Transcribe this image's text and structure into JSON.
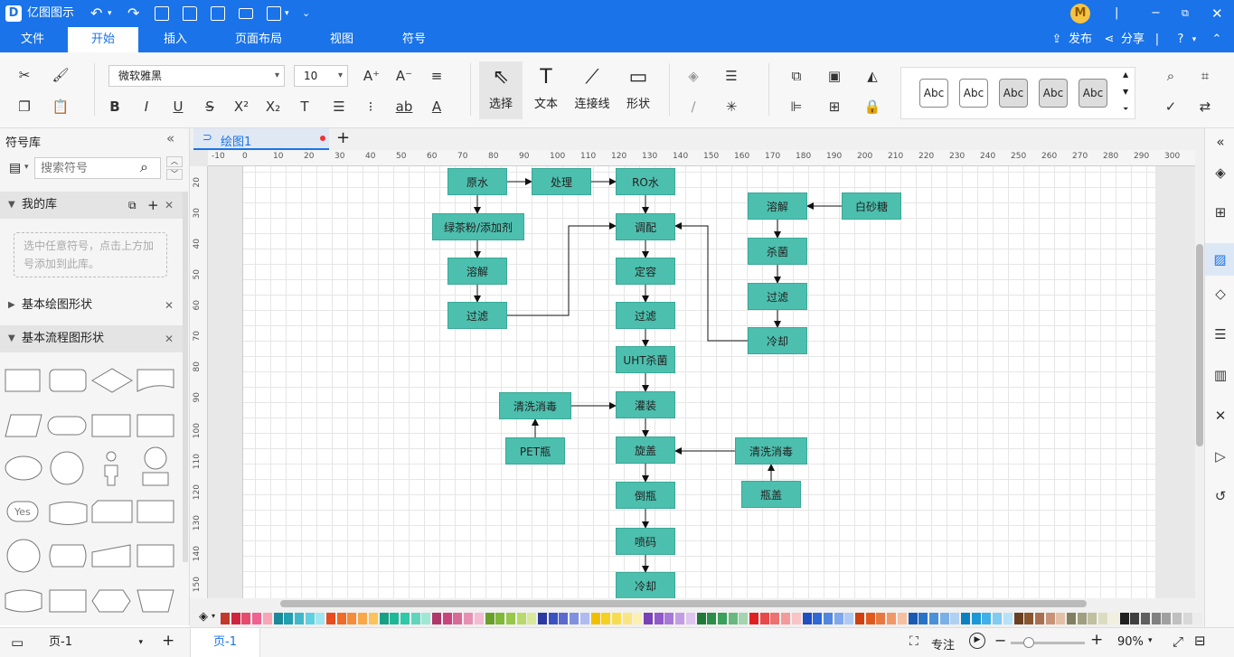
{
  "app": {
    "title": "亿图图示",
    "logo": "D"
  },
  "user": {
    "avatar_letter": "M"
  },
  "menu": {
    "items": [
      "文件",
      "开始",
      "插入",
      "页面布局",
      "视图",
      "符号"
    ],
    "active": "开始",
    "publish": "发布",
    "share": "分享"
  },
  "ribbon": {
    "font": "微软雅黑",
    "size": "10",
    "tools": [
      {
        "label": "选择"
      },
      {
        "label": "文本"
      },
      {
        "label": "连接线"
      },
      {
        "label": "形状"
      }
    ],
    "style_label": "Abc"
  },
  "left_panel": {
    "title": "符号库",
    "search_placeholder": "搜索符号",
    "my_lib": "我的库",
    "my_lib_hint": "选中任意符号，点击上方加号添加到此库。",
    "basic_shapes": "基本绘图形状",
    "flow_shapes": "基本流程图形状",
    "yes_label": "Yes"
  },
  "tab": {
    "name": "绘图1"
  },
  "ruler": {
    "h": [
      "-10",
      "0",
      "10",
      "20",
      "30",
      "40",
      "50",
      "60",
      "70",
      "80",
      "90",
      "100",
      "110",
      "120",
      "130",
      "140",
      "150",
      "160",
      "170",
      "180",
      "190",
      "200",
      "210",
      "220",
      "230",
      "240",
      "250",
      "260",
      "270",
      "280",
      "290",
      "300"
    ],
    "v": [
      "20",
      "30",
      "40",
      "50",
      "60",
      "70",
      "80",
      "90",
      "100",
      "110",
      "120",
      "130",
      "140",
      "150"
    ]
  },
  "diagram": {
    "nodes": [
      {
        "id": "n1",
        "label": "原水"
      },
      {
        "id": "n2",
        "label": "处理"
      },
      {
        "id": "n3",
        "label": "RO水"
      },
      {
        "id": "n4",
        "label": "绿茶粉/添加剂"
      },
      {
        "id": "n5",
        "label": "溶解"
      },
      {
        "id": "n6",
        "label": "过滤"
      },
      {
        "id": "n7",
        "label": "调配"
      },
      {
        "id": "n8",
        "label": "定容"
      },
      {
        "id": "n9",
        "label": "过滤"
      },
      {
        "id": "n10",
        "label": "UHT杀菌"
      },
      {
        "id": "n11",
        "label": "灌装"
      },
      {
        "id": "n12",
        "label": "旋盖"
      },
      {
        "id": "n13",
        "label": "倒瓶"
      },
      {
        "id": "n14",
        "label": "喷码"
      },
      {
        "id": "n15",
        "label": "冷却"
      },
      {
        "id": "n16",
        "label": "溶解"
      },
      {
        "id": "n17",
        "label": "白砂糖"
      },
      {
        "id": "n18",
        "label": "杀菌"
      },
      {
        "id": "n19",
        "label": "过滤"
      },
      {
        "id": "n20",
        "label": "冷却"
      },
      {
        "id": "n21",
        "label": "清洗消毒"
      },
      {
        "id": "n22",
        "label": "PET瓶"
      },
      {
        "id": "n23",
        "label": "清洗消毒"
      },
      {
        "id": "n24",
        "label": "瓶盖"
      }
    ]
  },
  "status": {
    "page_select": "页-1",
    "page_tab": "页-1",
    "focus": "专注",
    "zoom": "90%"
  }
}
